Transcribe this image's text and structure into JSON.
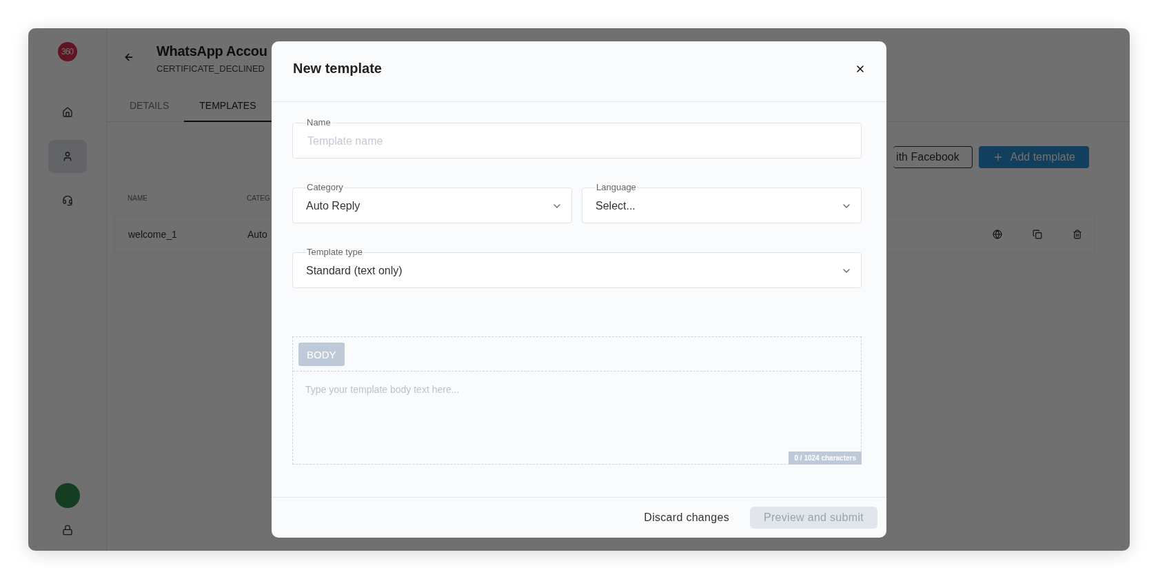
{
  "sidebar": {
    "logo": "360",
    "items": [
      {
        "kind": "home",
        "selected": false
      },
      {
        "kind": "user",
        "selected": true
      },
      {
        "kind": "headset",
        "selected": false
      }
    ]
  },
  "header": {
    "title": "WhatsApp Accou",
    "subtitle": "CERTIFICATE_DECLINED"
  },
  "tabs": [
    {
      "label": "DETAILS",
      "selected": false
    },
    {
      "label": "TEMPLATES",
      "selected": true
    }
  ],
  "actions": [
    {
      "label": "ith Facebook",
      "kind": "outline"
    },
    {
      "label": "Add template",
      "kind": "primary"
    }
  ],
  "table": {
    "columns": [
      "NAME",
      "CATEG"
    ],
    "rows": [
      {
        "cells": [
          "welcome_1",
          "Auto"
        ]
      }
    ]
  },
  "modal": {
    "title": "New template",
    "fields": [
      {
        "label": "Name",
        "kind": "text",
        "placeholder": "Template name"
      },
      {
        "label": "Category",
        "kind": "select",
        "value": "Auto Reply"
      },
      {
        "label": "Language",
        "kind": "select",
        "value": "Select..."
      },
      {
        "label": "Template type",
        "kind": "select",
        "value": "Standard (text only)"
      }
    ],
    "body": {
      "tab": "BODY",
      "placeholder": "Type your template body text here...",
      "counter": "0 / 1024 characters"
    },
    "buttons": [
      {
        "label": "Discard changes",
        "kind": "text",
        "disabled": false
      },
      {
        "label": "Preview and submit",
        "kind": "filled",
        "disabled": true
      }
    ]
  }
}
